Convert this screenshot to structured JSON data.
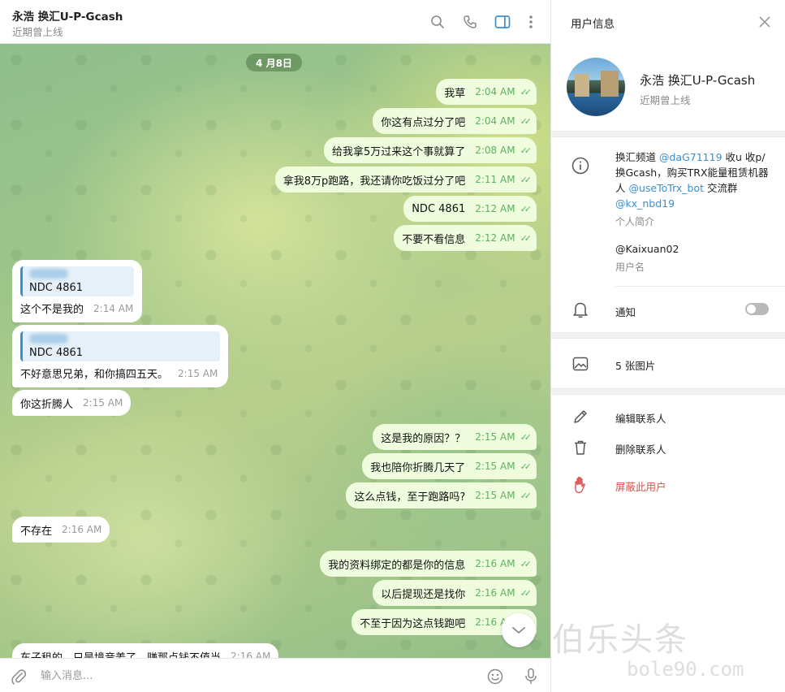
{
  "header": {
    "title": "永浩 换汇U-P-Gcash",
    "status": "近期曾上线"
  },
  "date_divider": "4 月8日",
  "messages": [
    {
      "text": "我草",
      "time": "2:04 AM"
    },
    {
      "text": "你这有点过分了吧",
      "time": "2:04 AM"
    },
    {
      "text": "给我拿5万过来这个事就算了",
      "time": "2:08 AM"
    },
    {
      "text": "拿我8万p跑路，我还请你吃饭过分了吧",
      "time": "2:11 AM"
    },
    {
      "text": "NDC 4861",
      "time": "2:12 AM"
    },
    {
      "text": "不要不看信息",
      "time": "2:12 AM"
    },
    {
      "quote": "NDC 4861",
      "text": "这个不是我的",
      "time": "2:14 AM"
    },
    {
      "quote": "NDC 4861",
      "text": "不好意思兄弟，和你搞四五天。",
      "time": "2:15 AM"
    },
    {
      "text": "你这折腾人",
      "time": "2:15 AM"
    },
    {
      "text": "这是我的原因？？",
      "time": "2:15 AM"
    },
    {
      "text": "我也陪你折腾几天了",
      "time": "2:15 AM"
    },
    {
      "text": "这么点钱，至于跑路吗?",
      "time": "2:15 AM"
    },
    {
      "text": "不存在",
      "time": "2:16 AM"
    },
    {
      "text": "我的资料绑定的都是你的信息",
      "time": "2:16 AM"
    },
    {
      "text": "以后提现还是找你",
      "time": "2:16 AM"
    },
    {
      "text": "不至于因为这点钱跑吧",
      "time": "2:16 AM"
    },
    {
      "text": "车子租的，只是境音姜了，赚那点钱不值当",
      "time": "2:16 AM"
    }
  ],
  "composer": {
    "placeholder": "输入消息..."
  },
  "panel": {
    "title": "用户信息",
    "name": "永浩 换汇U-P-Gcash",
    "status": "近期曾上线",
    "bio": {
      "p1": "换汇频道 ",
      "l1": "@daG71119",
      "p2": " 收u 收p/ 换Gcash，购买TRX能量租赁机器人 ",
      "l2": "@useToTrx_bot",
      "p3": " 交流群 ",
      "l3": "@kx_nbd19"
    },
    "bio_label": "个人简介",
    "username": "@Kaixuan02",
    "username_label": "用户名",
    "notifications_label": "通知",
    "notifications_on": false,
    "photos_label": "5 张图片",
    "edit_label": "编辑联系人",
    "delete_label": "删除联系人",
    "block_label": "屏蔽此用户"
  },
  "watermark": {
    "text": "伯乐头条",
    "url": "bole90.com"
  },
  "colors": {
    "accent": "#3b8fce",
    "outgoing_bubble": "#effdde",
    "check": "#5fb060",
    "danger": "#d9534f"
  }
}
